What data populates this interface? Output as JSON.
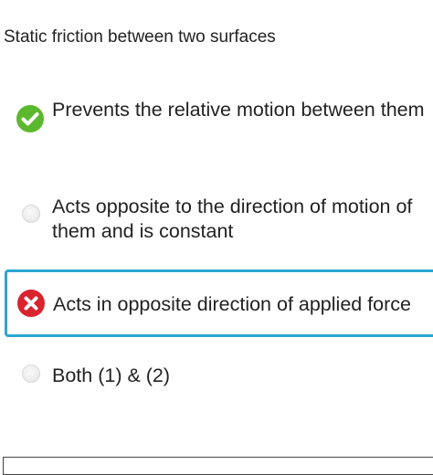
{
  "question": {
    "text": "Static friction between two surfaces"
  },
  "options": [
    {
      "label": "Prevents the relative motion between them",
      "state": "correct",
      "icon": "check-circle-icon",
      "color": "#5cb82e"
    },
    {
      "label": "Acts opposite to the direction of motion of them and is constant",
      "state": "unselected",
      "icon": "radio-icon"
    },
    {
      "label": "Acts in opposite direction of applied force",
      "state": "wrong",
      "icon": "x-circle-icon",
      "color": "#d9232e",
      "highlight_color": "#2aa7d2"
    },
    {
      "label": "Both (1) & (2)",
      "state": "unselected",
      "icon": "radio-icon"
    }
  ]
}
